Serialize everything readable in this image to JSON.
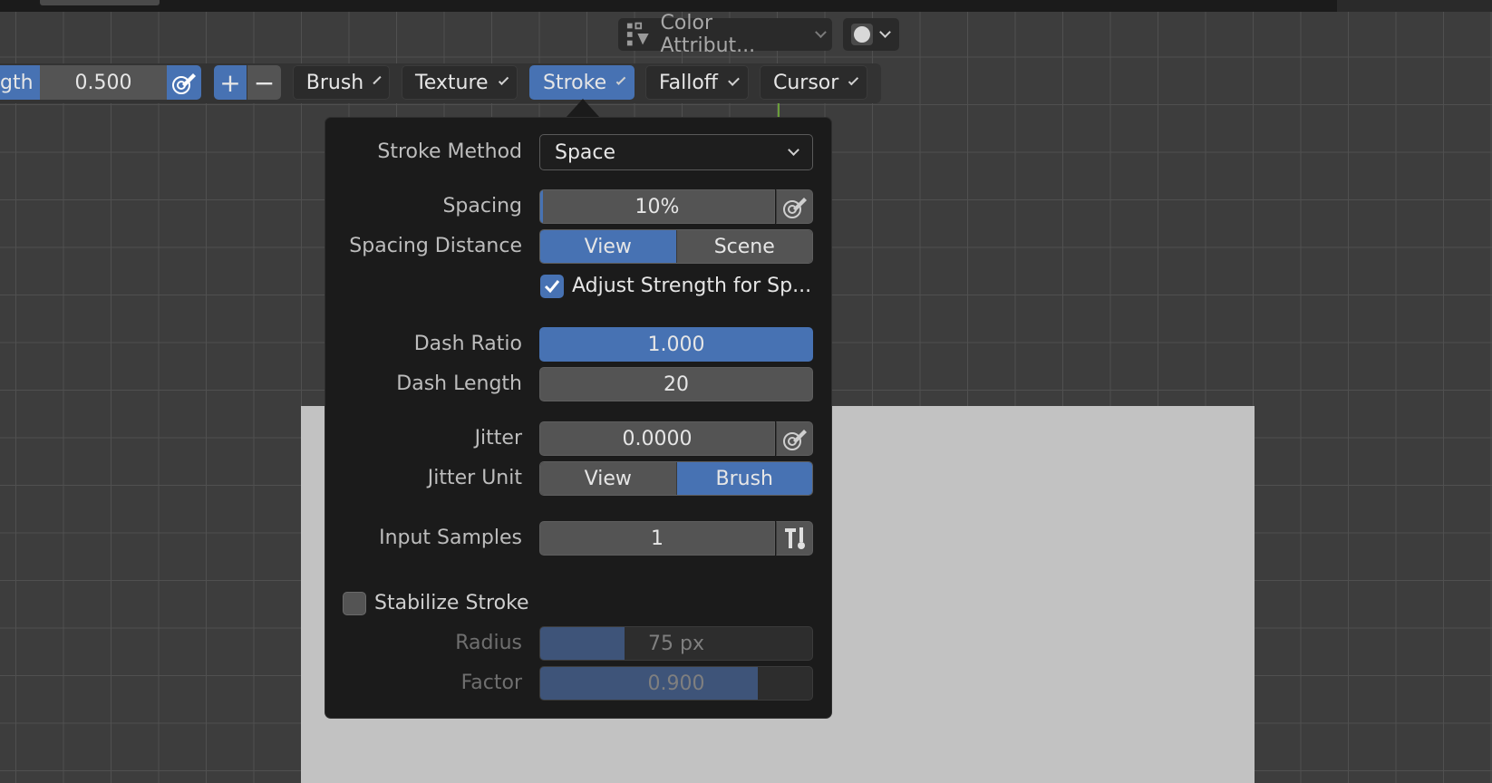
{
  "viewport_header": {
    "color_attribute_label": "Color Attribut...",
    "shading_icon": "sphere-icon"
  },
  "toolbar": {
    "strength_label": "gth",
    "strength_value": "0.500",
    "add_icon": "+",
    "subtract_icon": "−",
    "menus": [
      "Brush",
      "Texture",
      "Stroke",
      "Falloff",
      "Cursor"
    ],
    "active_menu": "Stroke"
  },
  "stroke_panel": {
    "stroke_method": {
      "label": "Stroke Method",
      "value": "Space"
    },
    "spacing": {
      "label": "Spacing",
      "value": "10%",
      "fill": 0.1
    },
    "spacing_distance": {
      "label": "Spacing Distance",
      "options": [
        "View",
        "Scene"
      ],
      "selected": "View"
    },
    "adjust_strength": {
      "label": "Adjust Strength for Sp...",
      "checked": true
    },
    "dash_ratio": {
      "label": "Dash Ratio",
      "value": "1.000",
      "fill": 1.0
    },
    "dash_length": {
      "label": "Dash Length",
      "value": "20"
    },
    "jitter": {
      "label": "Jitter",
      "value": "0.0000"
    },
    "jitter_unit": {
      "label": "Jitter Unit",
      "options": [
        "View",
        "Brush"
      ],
      "selected": "Brush"
    },
    "input_samples": {
      "label": "Input Samples",
      "value": "1"
    },
    "stabilize_stroke": {
      "label": "Stabilize Stroke",
      "checked": false
    },
    "radius": {
      "label": "Radius",
      "value": "75 px",
      "fill": 0.31
    },
    "factor": {
      "label": "Factor",
      "value": "0.900",
      "fill": 0.9
    }
  },
  "colors": {
    "accent": "#4772b3",
    "panel_bg": "#1b1b1b",
    "field_bg": "#545454",
    "viewport_bg": "#3d3d3d",
    "canvas": "#c2c2c2"
  }
}
